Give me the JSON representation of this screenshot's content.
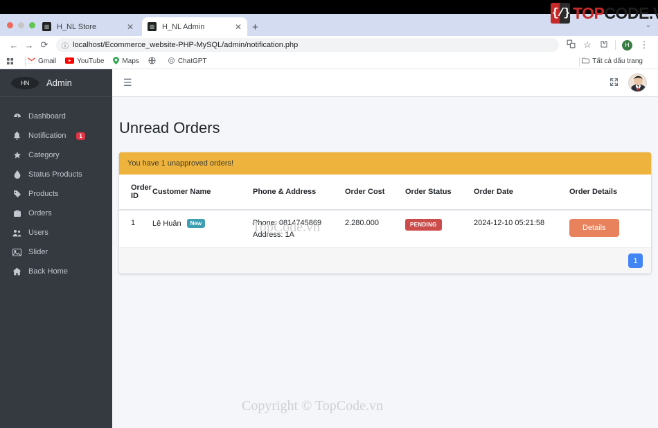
{
  "watermark": {
    "logo_brackets": "{/}",
    "logo_top": "TOP",
    "logo_code": "CODE",
    "logo_vn": ".VN",
    "table_text": "TopCode.vn",
    "footer_text": "Copyright © TopCode.vn"
  },
  "browser": {
    "tabs": [
      {
        "title": "H_NL Store",
        "close": "✕",
        "favicon": "store-favicon"
      },
      {
        "title": "H_NL Admin",
        "close": "✕",
        "favicon": "admin-favicon"
      }
    ],
    "new_tab": "+",
    "tab_list_chevron": "⌄",
    "nav": {
      "back": "←",
      "forward": "→",
      "reload": "⟳"
    },
    "omnibox": {
      "info_icon": "ⓘ",
      "url": "localhost/Ecommerce_website-PHP-MySQL/admin/notification.php"
    },
    "toolbar_right": {
      "translate": "translate-icon",
      "bookmark_star": "☆",
      "extensions": "extensions-icon",
      "profile_initial": "H",
      "menu": "⋮"
    },
    "bookmarks": [
      {
        "label": "",
        "icon": "apps-grid-icon"
      },
      {
        "label": "Gmail",
        "icon": "gmail-icon"
      },
      {
        "label": "YouTube",
        "icon": "youtube-icon"
      },
      {
        "label": "Maps",
        "icon": "maps-icon"
      },
      {
        "label": "",
        "icon": "globe-icon"
      },
      {
        "label": "ChatGPT",
        "icon": "chatgpt-icon"
      }
    ],
    "all_bookmarks": {
      "label": "Tất cả dấu trang",
      "icon": "folder-icon"
    }
  },
  "sidebar": {
    "logo_text": "HN",
    "brand": "Admin",
    "items": [
      {
        "label": "Dashboard",
        "icon": "dashboard-icon",
        "glyph": "◴"
      },
      {
        "label": "Notification",
        "icon": "bell-icon",
        "glyph": "🔔",
        "badge": "1"
      },
      {
        "label": "Category",
        "icon": "star-icon",
        "glyph": "★"
      },
      {
        "label": "Status Products",
        "icon": "droplet-icon",
        "glyph": "💧"
      },
      {
        "label": "Products",
        "icon": "tag-icon",
        "glyph": "🏷"
      },
      {
        "label": "Orders",
        "icon": "briefcase-icon",
        "glyph": "💼"
      },
      {
        "label": "Users",
        "icon": "users-icon",
        "glyph": "👥"
      },
      {
        "label": "Slider",
        "icon": "image-icon",
        "glyph": "🖼"
      },
      {
        "label": "Back Home",
        "icon": "home-icon",
        "glyph": "🏠"
      }
    ]
  },
  "adminbar": {
    "hamburger": "☰",
    "expand": "⤡",
    "avatar": "user-avatar"
  },
  "main": {
    "page_title": "Unread Orders",
    "alert": "You have 1 unapproved orders!",
    "table": {
      "headers": [
        "Order ID",
        "Customer Name",
        "Phone & Address",
        "Order Cost",
        "Order Status",
        "Order Date",
        "Order Details"
      ],
      "rows": [
        {
          "order_id": "1",
          "customer_name": "Lê Huân",
          "customer_badge": "New",
          "phone": "Phone: 0814745869",
          "address": "Address: 1A",
          "order_cost": "2.280.000",
          "order_status": "PENDING",
          "order_date": "2024-12-10 05:21:58",
          "details_label": "Details"
        }
      ]
    },
    "pagination": {
      "current": "1"
    }
  },
  "colors": {
    "sidebar_bg": "#343a40",
    "alert_bg": "#eeb33c",
    "new_badge": "#3e9fb3",
    "pending_badge": "#cc4b4b",
    "details_btn": "#e8825c",
    "page_btn": "#4285f4",
    "notification_badge": "#dc3545"
  }
}
